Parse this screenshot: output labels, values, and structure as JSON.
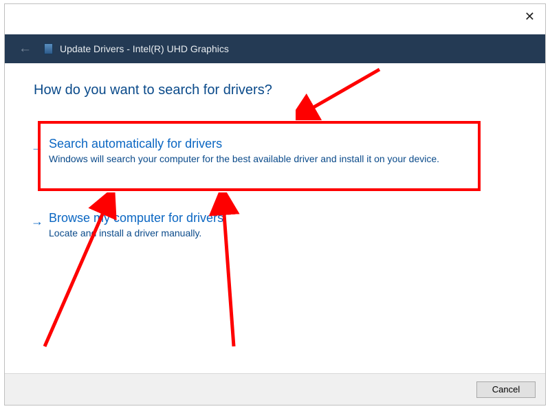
{
  "header": {
    "title": "Update Drivers - Intel(R) UHD Graphics"
  },
  "heading": "How do you want to search for drivers?",
  "options": [
    {
      "title": "Search automatically for drivers",
      "desc": "Windows will search your computer for the best available driver and install it on your device."
    },
    {
      "title": "Browse my computer for drivers",
      "desc": "Locate and install a driver manually."
    }
  ],
  "footer": {
    "cancel": "Cancel"
  }
}
